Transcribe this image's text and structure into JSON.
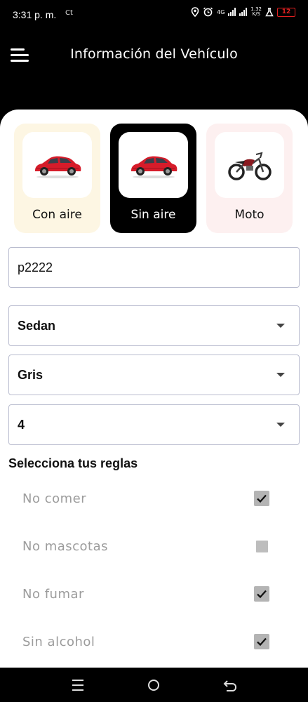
{
  "status_bar": {
    "time": "3:31 p. m.",
    "extra_icon": "Ct",
    "network": "4G",
    "speed_value": "1.32",
    "speed_unit": "K/S",
    "battery": "12",
    "icons": [
      "location-icon",
      "alarm-icon",
      "signal-icon",
      "flask-icon",
      "battery-icon"
    ],
    "battery_color": "#e02020"
  },
  "app_bar": {
    "title": "Información del Vehículo",
    "menu_icon": "hamburger-menu-icon"
  },
  "vehicle_types": [
    {
      "label": "Con aire",
      "icon": "red-car-icon",
      "selected": false,
      "bg": "#fdf6e3"
    },
    {
      "label": "Sin aire",
      "icon": "red-car-icon",
      "selected": true,
      "bg": "#000000"
    },
    {
      "label": "Moto",
      "icon": "motorcycle-icon",
      "selected": false,
      "bg": "#fdf0f0"
    }
  ],
  "form": {
    "plate": "p2222",
    "body_type": "Sedan",
    "color": "Gris",
    "seats": "4"
  },
  "rules": {
    "title": "Selecciona tus reglas",
    "items": [
      {
        "label": "No comer",
        "checked": true
      },
      {
        "label": "No mascotas",
        "checked": false
      },
      {
        "label": "No fumar",
        "checked": true
      },
      {
        "label": "Sin alcohol",
        "checked": true
      }
    ]
  },
  "nav_bar": {
    "buttons": [
      "recents-icon",
      "home-icon",
      "back-icon"
    ]
  }
}
